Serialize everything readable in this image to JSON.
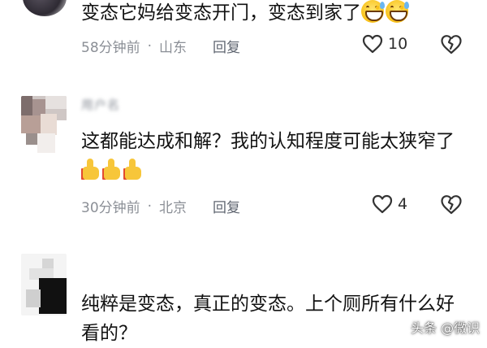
{
  "comments": [
    {
      "text": "变态它妈给变态开门，变态到家了",
      "emoji_after": [
        "grinning-sweat-emoji",
        "grinning-sweat-emoji"
      ],
      "time": "58分钟前",
      "location": "山东",
      "reply": "回复",
      "likes": "10"
    },
    {
      "username": "用户名",
      "text": "这都能达成和解？我的认知程度可能太狭窄了",
      "emoji_after": [
        "thumbs-up-emoji",
        "thumbs-up-emoji",
        "thumbs-up-emoji"
      ],
      "time": "30分钟前",
      "location": "北京",
      "reply": "回复",
      "likes": "4"
    },
    {
      "text": "纯粹是变态，真正的变态。上个厕所有什么好看的？"
    }
  ],
  "separator": "·",
  "watermark": "头条 @微识",
  "colors": {
    "meta": "#8b8f96",
    "text": "#121212",
    "like_icon": "#333333"
  }
}
